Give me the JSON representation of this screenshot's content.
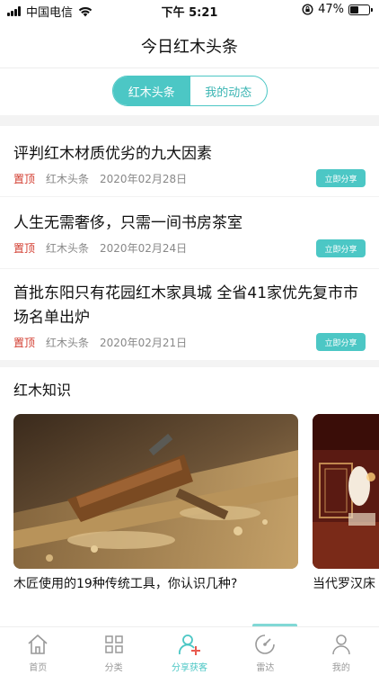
{
  "status_bar": {
    "carrier": "中国电信",
    "time": "下午 5:21",
    "battery": "47%",
    "battery_level": 0.47
  },
  "header": {
    "title": "今日红木头条"
  },
  "tabs": [
    {
      "label": "红木头条",
      "active": true
    },
    {
      "label": "我的动态",
      "active": false
    }
  ],
  "news": [
    {
      "title": "评判红木材质优劣的九大因素",
      "pin": "置顶",
      "source": "红木头条",
      "date": "2020年02月28日",
      "share": "立即分享"
    },
    {
      "title": "人生无需奢侈，只需一间书房茶室",
      "pin": "置顶",
      "source": "红木头条",
      "date": "2020年02月24日",
      "share": "立即分享"
    },
    {
      "title": "首批东阳只有花园红木家具城 全省41家优先复市市场名单出炉",
      "pin": "置顶",
      "source": "红木头条",
      "date": "2020年02月21日",
      "share": "立即分享"
    }
  ],
  "knowledge": {
    "title": "红木知识",
    "cards": [
      {
        "caption": "木匠使用的19种传统工具，你认识几种?"
      },
      {
        "caption": "当代罗汉床"
      }
    ]
  },
  "tabbar": [
    {
      "label": "首页",
      "icon": "home-icon",
      "active": false
    },
    {
      "label": "分类",
      "icon": "grid-icon",
      "active": false
    },
    {
      "label": "分享获客",
      "icon": "add-user-icon",
      "active": true
    },
    {
      "label": "雷达",
      "icon": "radar-icon",
      "active": false
    },
    {
      "label": "我的",
      "icon": "person-icon",
      "active": false
    }
  ],
  "colors": {
    "accent": "#4cc7c5",
    "pin": "#d23b2e"
  }
}
